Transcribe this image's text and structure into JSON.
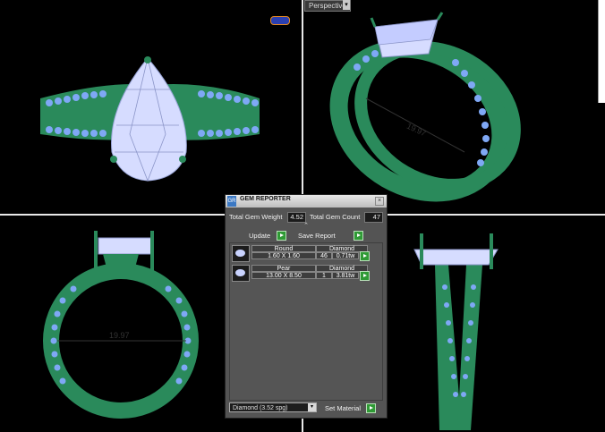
{
  "viewport": {
    "projection_label": "Perspective",
    "dimension_label": "19.97"
  },
  "gem_reporter": {
    "title": "GEM REPORTER",
    "logo_text": "GR",
    "total_weight_label": "Total Gem Weight",
    "total_weight_value": "4.52",
    "total_count_label": "Total Gem Count",
    "total_count_value": "47",
    "update_label": "Update",
    "save_report_label": "Save Report",
    "gems": [
      {
        "shape": "Round",
        "size": "1.60 X 1.60",
        "material": "Diamond",
        "count": "46",
        "weight": "0.71tw"
      },
      {
        "shape": "Pear",
        "size": "13.00 X 8.50",
        "material": "Diamond",
        "count": "1",
        "weight": "3.81tw"
      }
    ],
    "material_select": "Diamond    (3.52 spg)",
    "set_material_label": "Set Material"
  },
  "colors": {
    "metal": "#2a8a5b",
    "gem": "#d6dcff",
    "gem_accent": "#6f9ff0",
    "background": "#000000",
    "panel": "#545454"
  }
}
